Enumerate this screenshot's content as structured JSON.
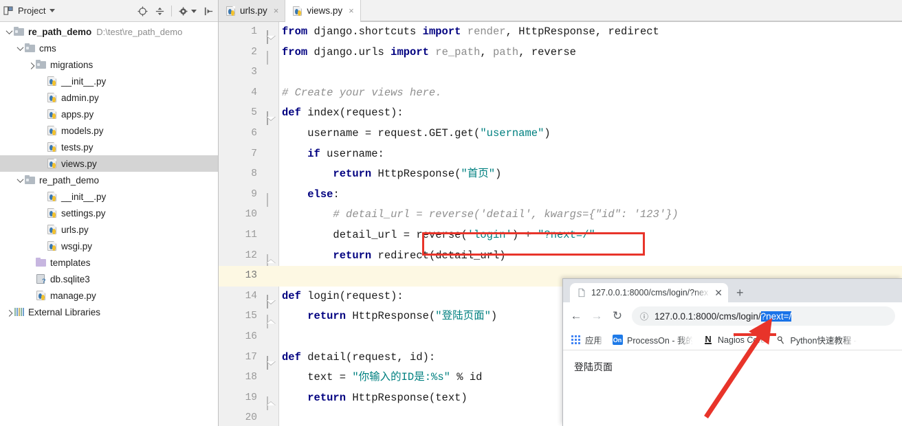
{
  "ide": {
    "panel": {
      "title": "Project",
      "icons": [
        "project-view-icon",
        "chevron-down-icon",
        "locate-icon",
        "collapse-all-icon",
        "settings-gear-icon",
        "hide-panel-icon"
      ]
    },
    "tree": [
      {
        "label": "re_path_demo",
        "path": "D:\\test\\re_path_demo",
        "type": "folder-root",
        "indent": 0,
        "arrow": "down",
        "bold": true,
        "selected": false
      },
      {
        "label": "cms",
        "path": "",
        "type": "folder-src",
        "indent": 1,
        "arrow": "down",
        "bold": false,
        "selected": false
      },
      {
        "label": "migrations",
        "path": "",
        "type": "folder-src",
        "indent": 2,
        "arrow": "right",
        "bold": false,
        "selected": false
      },
      {
        "label": "__init__.py",
        "path": "",
        "type": "python",
        "indent": 3,
        "arrow": "none",
        "bold": false,
        "selected": false
      },
      {
        "label": "admin.py",
        "path": "",
        "type": "python",
        "indent": 3,
        "arrow": "none",
        "bold": false,
        "selected": false
      },
      {
        "label": "apps.py",
        "path": "",
        "type": "python",
        "indent": 3,
        "arrow": "none",
        "bold": false,
        "selected": false
      },
      {
        "label": "models.py",
        "path": "",
        "type": "python",
        "indent": 3,
        "arrow": "none",
        "bold": false,
        "selected": false
      },
      {
        "label": "tests.py",
        "path": "",
        "type": "python",
        "indent": 3,
        "arrow": "none",
        "bold": false,
        "selected": false
      },
      {
        "label": "views.py",
        "path": "",
        "type": "python",
        "indent": 3,
        "arrow": "none",
        "bold": false,
        "selected": true
      },
      {
        "label": "re_path_demo",
        "path": "",
        "type": "folder-src",
        "indent": 1,
        "arrow": "down",
        "bold": false,
        "selected": false
      },
      {
        "label": "__init__.py",
        "path": "",
        "type": "python",
        "indent": 3,
        "arrow": "none",
        "bold": false,
        "selected": false
      },
      {
        "label": "settings.py",
        "path": "",
        "type": "python",
        "indent": 3,
        "arrow": "none",
        "bold": false,
        "selected": false
      },
      {
        "label": "urls.py",
        "path": "",
        "type": "python",
        "indent": 3,
        "arrow": "none",
        "bold": false,
        "selected": false
      },
      {
        "label": "wsgi.py",
        "path": "",
        "type": "python",
        "indent": 3,
        "arrow": "none",
        "bold": false,
        "selected": false
      },
      {
        "label": "templates",
        "path": "",
        "type": "folder-templates",
        "indent": 2,
        "arrow": "none",
        "bold": false,
        "selected": false
      },
      {
        "label": "db.sqlite3",
        "path": "",
        "type": "db",
        "indent": 2,
        "arrow": "none",
        "bold": false,
        "selected": false
      },
      {
        "label": "manage.py",
        "path": "",
        "type": "python",
        "indent": 2,
        "arrow": "none",
        "bold": false,
        "selected": false
      },
      {
        "label": "External Libraries",
        "path": "",
        "type": "ext-lib",
        "indent": 0,
        "arrow": "right",
        "bold": false,
        "selected": false
      }
    ],
    "tabs": [
      {
        "label": "urls.py",
        "active": false,
        "close": "×"
      },
      {
        "label": "views.py",
        "active": true,
        "close": "×"
      }
    ],
    "code": [
      {
        "n": "1",
        "fold": "open",
        "current": false,
        "tokens": [
          {
            "t": "from",
            "c": "kw"
          },
          {
            "t": " django.shortcuts ",
            "c": "id"
          },
          {
            "t": "import",
            "c": "kw"
          },
          {
            "t": " ",
            "c": "id"
          },
          {
            "t": "render",
            "c": "fade"
          },
          {
            "t": ", ",
            "c": "id"
          },
          {
            "t": "HttpResponse",
            "c": "id"
          },
          {
            "t": ", ",
            "c": "id"
          },
          {
            "t": "redirect",
            "c": "id"
          }
        ]
      },
      {
        "n": "2",
        "fold": "mid",
        "current": false,
        "tokens": [
          {
            "t": "from",
            "c": "kw"
          },
          {
            "t": " django.urls ",
            "c": "id"
          },
          {
            "t": "import",
            "c": "kw"
          },
          {
            "t": " ",
            "c": "id"
          },
          {
            "t": "re_path",
            "c": "fade"
          },
          {
            "t": ", ",
            "c": "id"
          },
          {
            "t": "path",
            "c": "fade"
          },
          {
            "t": ", ",
            "c": "id"
          },
          {
            "t": "reverse",
            "c": "id"
          }
        ]
      },
      {
        "n": "3",
        "fold": "none",
        "current": false,
        "tokens": []
      },
      {
        "n": "4",
        "fold": "none",
        "current": false,
        "tokens": [
          {
            "t": "# Create your views here.",
            "c": "cmt"
          }
        ]
      },
      {
        "n": "5",
        "fold": "open",
        "current": false,
        "tokens": [
          {
            "t": "def",
            "c": "kw"
          },
          {
            "t": " index(request):",
            "c": "id"
          }
        ]
      },
      {
        "n": "6",
        "fold": "none",
        "current": false,
        "tokens": [
          {
            "t": "    username = request.GET.get(",
            "c": "id"
          },
          {
            "t": "″username″",
            "c": "str"
          },
          {
            "t": ")",
            "c": "id"
          }
        ]
      },
      {
        "n": "7",
        "fold": "none",
        "current": false,
        "tokens": [
          {
            "t": "    ",
            "c": "id"
          },
          {
            "t": "if",
            "c": "kw"
          },
          {
            "t": " username:",
            "c": "id"
          }
        ]
      },
      {
        "n": "8",
        "fold": "none",
        "current": false,
        "tokens": [
          {
            "t": "        ",
            "c": "id"
          },
          {
            "t": "return",
            "c": "kw"
          },
          {
            "t": " HttpResponse(",
            "c": "id"
          },
          {
            "t": "″首页″",
            "c": "str"
          },
          {
            "t": ")",
            "c": "id"
          }
        ]
      },
      {
        "n": "9",
        "fold": "mid",
        "current": false,
        "tokens": [
          {
            "t": "    ",
            "c": "id"
          },
          {
            "t": "else",
            "c": "kw"
          },
          {
            "t": ":",
            "c": "id"
          }
        ]
      },
      {
        "n": "10",
        "fold": "none",
        "current": false,
        "tokens": [
          {
            "t": "        # detail_url = reverse('detail', kwargs={″id″: '123'})",
            "c": "cmt"
          }
        ]
      },
      {
        "n": "11",
        "fold": "none",
        "current": false,
        "tokens": [
          {
            "t": "        detail_url = reverse(",
            "c": "id"
          },
          {
            "t": "'login'",
            "c": "str"
          },
          {
            "t": ") + ",
            "c": "id"
          },
          {
            "t": "″?next=/″",
            "c": "str"
          }
        ]
      },
      {
        "n": "12",
        "fold": "end",
        "current": false,
        "tokens": [
          {
            "t": "        ",
            "c": "id"
          },
          {
            "t": "return",
            "c": "kw"
          },
          {
            "t": " redirect(detail_url)",
            "c": "id"
          }
        ]
      },
      {
        "n": "13",
        "fold": "none",
        "current": true,
        "tokens": []
      },
      {
        "n": "14",
        "fold": "open",
        "current": false,
        "tokens": [
          {
            "t": "def",
            "c": "kw"
          },
          {
            "t": " login(request):",
            "c": "id"
          }
        ]
      },
      {
        "n": "15",
        "fold": "end",
        "current": false,
        "tokens": [
          {
            "t": "    ",
            "c": "id"
          },
          {
            "t": "return",
            "c": "kw"
          },
          {
            "t": " HttpResponse(",
            "c": "id"
          },
          {
            "t": "″登陆页面″",
            "c": "str"
          },
          {
            "t": ")",
            "c": "id"
          }
        ]
      },
      {
        "n": "16",
        "fold": "none",
        "current": false,
        "tokens": []
      },
      {
        "n": "17",
        "fold": "open",
        "current": false,
        "tokens": [
          {
            "t": "def",
            "c": "kw"
          },
          {
            "t": " detail(request, id):",
            "c": "id"
          }
        ]
      },
      {
        "n": "18",
        "fold": "none",
        "current": false,
        "tokens": [
          {
            "t": "    text = ",
            "c": "id"
          },
          {
            "t": "″你输入的ID是:%s″",
            "c": "str"
          },
          {
            "t": " % id",
            "c": "id"
          }
        ]
      },
      {
        "n": "19",
        "fold": "end",
        "current": false,
        "tokens": [
          {
            "t": "    ",
            "c": "id"
          },
          {
            "t": "return",
            "c": "kw"
          },
          {
            "t": " HttpResponse(text)",
            "c": "id"
          }
        ]
      },
      {
        "n": "20",
        "fold": "none",
        "current": false,
        "tokens": []
      }
    ]
  },
  "browser": {
    "tab": {
      "title": "127.0.0.1:8000/cms/login/?nex",
      "close": "✕",
      "favicon": "page-icon"
    },
    "new_tab": "+",
    "nav": {
      "back": "←",
      "forward": "→",
      "reload": "↻"
    },
    "omnibox": {
      "info_icon": "ⓘ",
      "url_prefix": "127.0.0.1:8000/cms/login/",
      "url_selected": "?next=/"
    },
    "bookmarks": [
      {
        "label": "应用",
        "icon": "apps-grid-icon"
      },
      {
        "label": "ProcessOn - 我的文",
        "icon": "processon-icon"
      },
      {
        "label": "Nagios Core",
        "icon": "nagios-icon"
      },
      {
        "label": "Python快速教程 - V…",
        "icon": "python-tutorial-icon"
      }
    ],
    "page_text": "登陆页面"
  },
  "annotations": {
    "accent_red": "#e8342a",
    "code_box_target": "reverse('login') + ″?next=/″",
    "url_underline_target": "?next=/"
  }
}
